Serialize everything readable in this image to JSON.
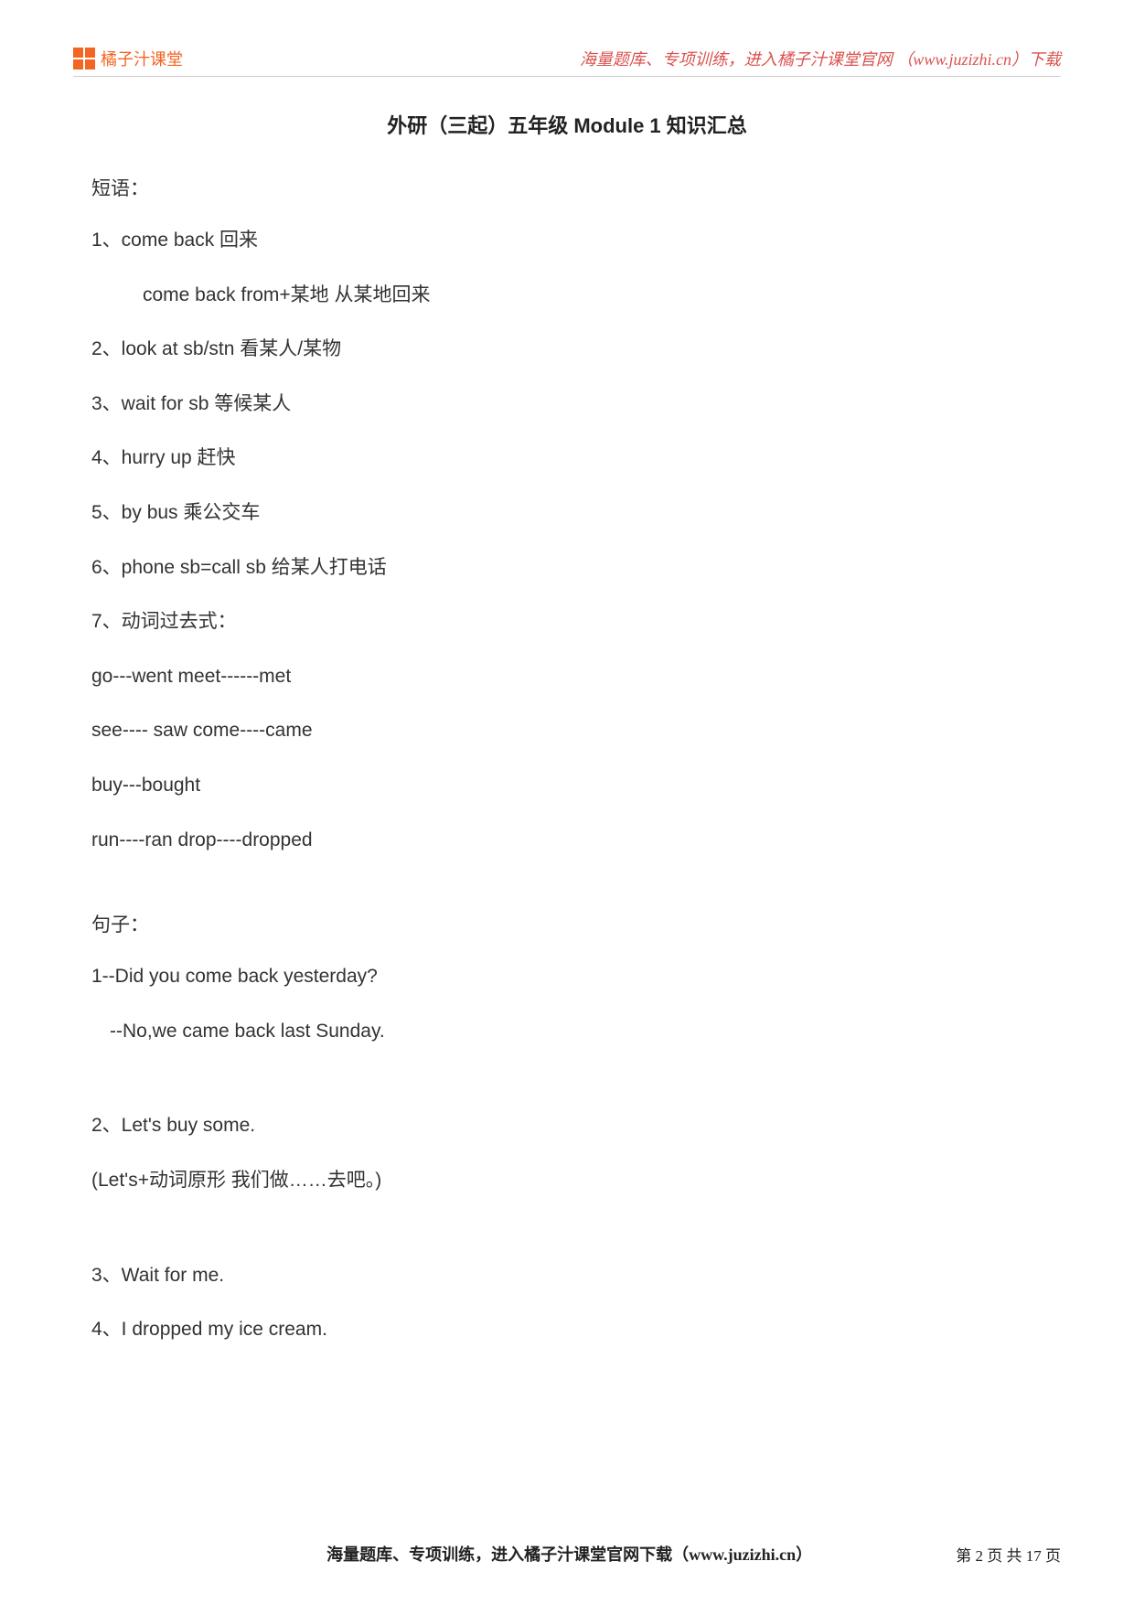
{
  "header": {
    "logo_text": "橘子汁课堂",
    "right_text": "海量题库、专项训练，进入橘子汁课堂官网 （www.juzizhi.cn）下载"
  },
  "title": "外研（三起）五年级 Module 1 知识汇总",
  "phrases_label": "短语：",
  "phrases": [
    "1、come back   回来",
    "come back from+某地  从某地回来",
    "2、look at sb/stn   看某人/某物",
    "3、wait for sb     等候某人",
    "4、hurry up     赶快",
    "5、by bus   乘公交车",
    "6、phone sb=call sb    给某人打电话",
    "7、动词过去式：",
    "go---went         meet------met",
    "see---- saw     come----came",
    "buy---bought",
    "run----ran      drop----dropped"
  ],
  "sentences_label": "句子：",
  "sentences": [
    "1--Did you come back yesterday?",
    "--No,we came back last Sunday.",
    "2、Let's buy some.",
    "(Let's+动词原形      我们做……去吧。)",
    "3、Wait for me.",
    "4、I dropped my ice cream."
  ],
  "footer": {
    "center": "海量题库、专项训练，进入橘子汁课堂官网下载（www.juzizhi.cn）",
    "right": "第 2 页 共 17 页"
  }
}
